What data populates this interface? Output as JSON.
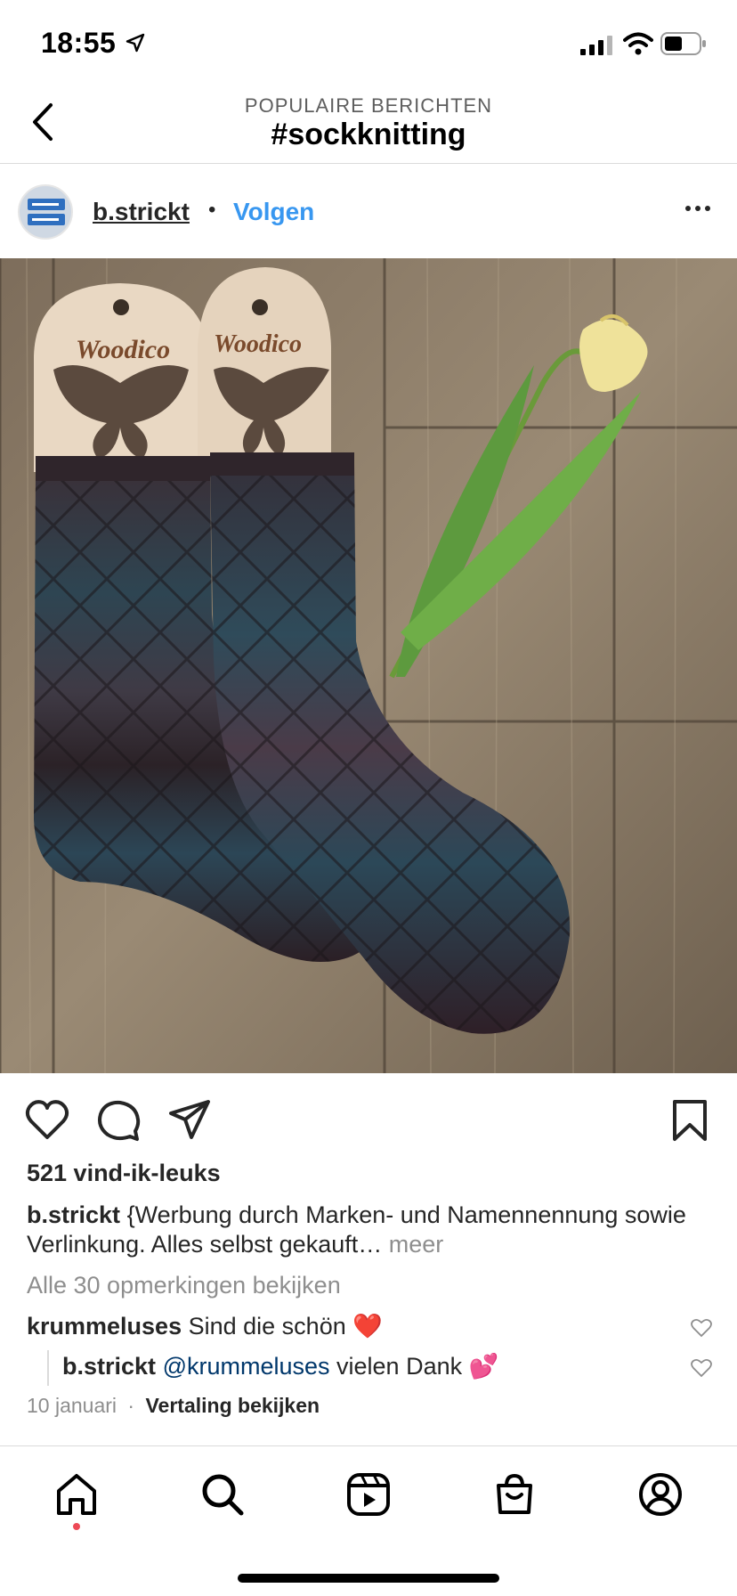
{
  "status": {
    "time": "18:55"
  },
  "header": {
    "subtitle": "POPULAIRE BERICHTEN",
    "title": "#sockknitting"
  },
  "post": {
    "username": "b.strickt",
    "dot": "•",
    "follow_label": "Volgen",
    "photo": {
      "board_text_left": "Woodico",
      "board_text_right": "Woodico"
    },
    "likes": "521 vind-ik-leuks",
    "caption_user": "b.strickt",
    "caption_text": "{Werbung durch Marken- und Namennennung sowie Verlinkung. Alles selbst gekauft…",
    "caption_more": "meer",
    "view_all_comments": "Alle 30 opmerkingen bekijken",
    "comments": [
      {
        "user": "krummeluses",
        "text": "Sind die schön",
        "emoji": "❤️"
      },
      {
        "user": "b.strickt",
        "mention": "@krummeluses",
        "text": "vielen Dank",
        "emoji": "💕"
      }
    ],
    "date": "10 januari",
    "meta_sep": "·",
    "translate_label": "Vertaling bekijken"
  },
  "colors": {
    "link": "#3897f0",
    "mention": "#00376b",
    "notification_dot": "#ed4956"
  },
  "icons": [
    "location-arrow-icon",
    "signal-icon",
    "wifi-icon",
    "battery-icon",
    "back-chevron-icon",
    "more-options-icon",
    "heart-icon",
    "comment-icon",
    "share-icon",
    "bookmark-icon",
    "home-icon",
    "search-icon",
    "reels-icon",
    "shop-icon",
    "profile-icon"
  ]
}
